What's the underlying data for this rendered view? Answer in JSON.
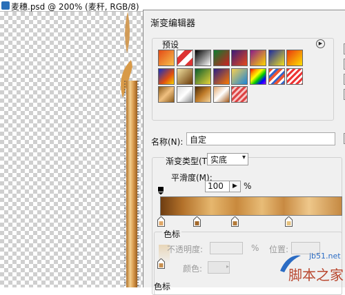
{
  "document": {
    "title": "麦穗.psd @ 200% (麦秆, RGB/8)"
  },
  "dialog": {
    "title": "渐变编辑器",
    "presets_label": "预设",
    "name_label": "名称(N):",
    "name_value": "自定",
    "gradient_type_label": "渐变类型(T):",
    "gradient_type_value": "实底",
    "smoothness_label": "平滑度(M):",
    "smoothness_value": "100",
    "smoothness_unit": "%",
    "color_stops_label": "色标",
    "opacity_label": "不透明度:",
    "opacity_unit": "%",
    "position_label": "位置:",
    "color_label": "颜色:",
    "color_stops_label_bottom": "色标"
  },
  "presets": [
    "linear-gradient(135deg,#e34a16,#f8c24c)",
    "linear-gradient(135deg,#fff 25%,#d33 25%,#d33 50%,#fff 50%,#fff 75%,#d33 75%)",
    "linear-gradient(135deg,#000,#fff)",
    "linear-gradient(135deg,#0b7d2f,#d02020)",
    "linear-gradient(135deg,#3b1a7a,#e84a1a)",
    "linear-gradient(135deg,#8a1a8a,#ffd700)",
    "linear-gradient(135deg,#1c2aa0,#f0e020)",
    "linear-gradient(135deg,#e83810,#ffe000)",
    "linear-gradient(135deg,#1530c0,#e05010 60%,#f7d000)",
    "linear-gradient(135deg,#f0e0a0,#6a3a08)",
    "linear-gradient(135deg,#0a5b2b,#e7d43a)",
    "linear-gradient(135deg,#2a1f84,#ff7a00)",
    "linear-gradient(135deg,#f9d050,#1a84d8)",
    "linear-gradient(135deg,#e00,#f90,#ff0,#0c0,#00f,#90f)",
    "repeating-linear-gradient(135deg,#e53 0 4px,#fff 4px 7px,#36c 7px 10px)",
    "repeating-linear-gradient(135deg,#e33 0 3px,#fff 3px 6px)",
    "linear-gradient(135deg,#8a5a1a,#f0c080,#8a5a1a)",
    "linear-gradient(135deg,#dcdcdc,#fff,#8a8a8a)",
    "linear-gradient(135deg,#4a2a08,#c07c2a,#f4d49a)",
    "linear-gradient(135deg,#e2a870,#fff 50%,#a45a1a)",
    "repeating-linear-gradient(135deg,#d44 0 3px,#f6c6c6 3px 6px)"
  ],
  "colors": {
    "dialog_bg": "#f0f0f0",
    "gradient_dark": "#6e3d12",
    "gradient_light": "#e8bc77",
    "watermark_site": "#2b6cc4",
    "watermark_text": "#b9472f"
  },
  "watermark": {
    "site": "jb51.net",
    "text": "脚本之家"
  }
}
